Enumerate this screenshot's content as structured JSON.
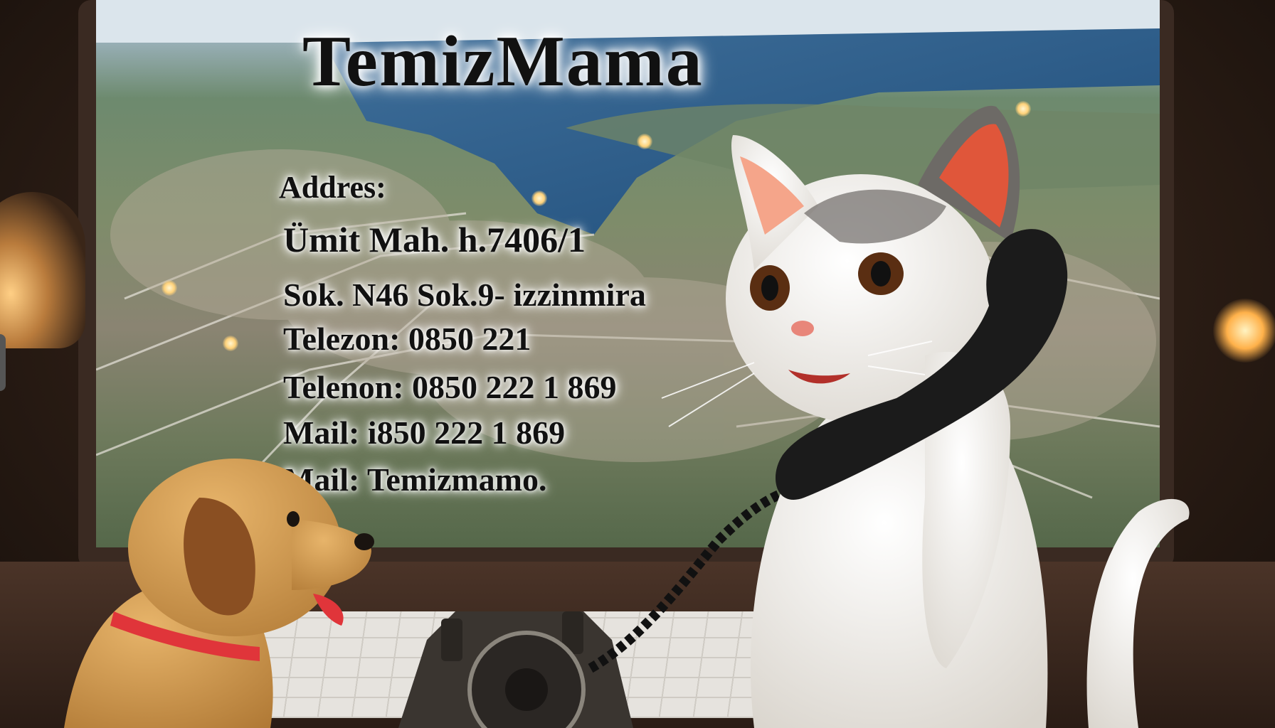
{
  "headline": "TemizMama",
  "info_lines": [
    "Addres:",
    "Ümit Mah.   h.7406/1",
    "Sok. N46 Sok.9- izzinmira",
    "Telezon: 0850 221",
    "Telenon: 0850 222 1 869",
    "Mail: i850 222 1 869",
    "Mail: Temizmamo."
  ],
  "colors": {
    "text": "#111111",
    "text_glow": "#ffffff",
    "collar": "#e0353a",
    "dog": "#d9a35a",
    "cat": "#f4f1ec"
  }
}
